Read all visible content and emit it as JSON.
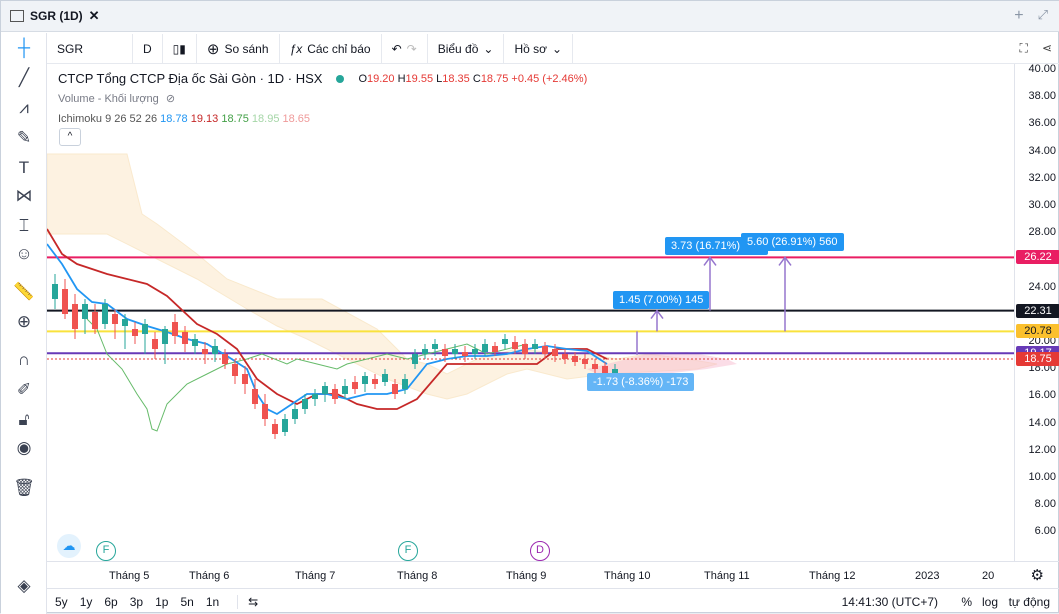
{
  "window": {
    "tab_title": "SGR (1D)"
  },
  "toolbar": {
    "symbol": "SGR",
    "interval": "D",
    "compare": "So sánh",
    "indicators": "Các chỉ báo",
    "chart_type": "Biểu đồ",
    "profile": "Hồ sơ"
  },
  "legend": {
    "title": "CTCP Tổng CTCP Địa ốc Sài Gòn · 1D · HSX",
    "o_label": "O",
    "o": "19.20",
    "h_label": "H",
    "h": "19.55",
    "l_label": "L",
    "l": "18.35",
    "c_label": "C",
    "c": "18.75",
    "change": "+0.45 (+2.46%)",
    "volume": "Volume - Khối lượng",
    "ichimoku": "Ichimoku 9 26 52 26",
    "ichi_vals": [
      "18.78",
      "19.13",
      "18.75",
      "18.95",
      "18.65"
    ],
    "ichi_colors": [
      "#2196f3",
      "#c62828",
      "#43a047",
      "#a5d6a7",
      "#ef9a9a"
    ],
    "collapse": "^"
  },
  "price_axis": {
    "ticks": [
      "40.00",
      "38.00",
      "36.00",
      "34.00",
      "32.00",
      "30.00",
      "28.00",
      "26.00",
      "24.00",
      "22.00",
      "20.00",
      "18.00",
      "16.00",
      "14.00",
      "12.00",
      "10.00",
      "8.00",
      "6.00"
    ]
  },
  "price_labels": [
    {
      "value": "26.22",
      "color": "#e91e63"
    },
    {
      "value": "22.31",
      "color": "#131722"
    },
    {
      "value": "20.78",
      "color": "#fbc02d"
    },
    {
      "value": "19.17",
      "color": "#673ab7"
    },
    {
      "value": "18.75",
      "color": "#e53935"
    }
  ],
  "measures": [
    {
      "text": "3.73 (16.71%) 373"
    },
    {
      "text": "5.60 (26.91%) 560"
    },
    {
      "text": "1.45 (7.00%) 145"
    },
    {
      "text": "-1.73 (-8.36%) -173"
    }
  ],
  "events": [
    {
      "t": "F"
    },
    {
      "t": "F"
    },
    {
      "t": "D"
    }
  ],
  "time_axis": [
    "Tháng 5",
    "Tháng 6",
    "Tháng 7",
    "Tháng 8",
    "Tháng 9",
    "Tháng 10",
    "Tháng 11",
    "Tháng 12",
    "2023",
    "20"
  ],
  "bottom": {
    "periods": [
      "5y",
      "1y",
      "6p",
      "3p",
      "1p",
      "5n",
      "1n"
    ],
    "clock": "14:41:30 (UTC+7)",
    "pct": "%",
    "log": "log",
    "auto": "tự động"
  }
}
